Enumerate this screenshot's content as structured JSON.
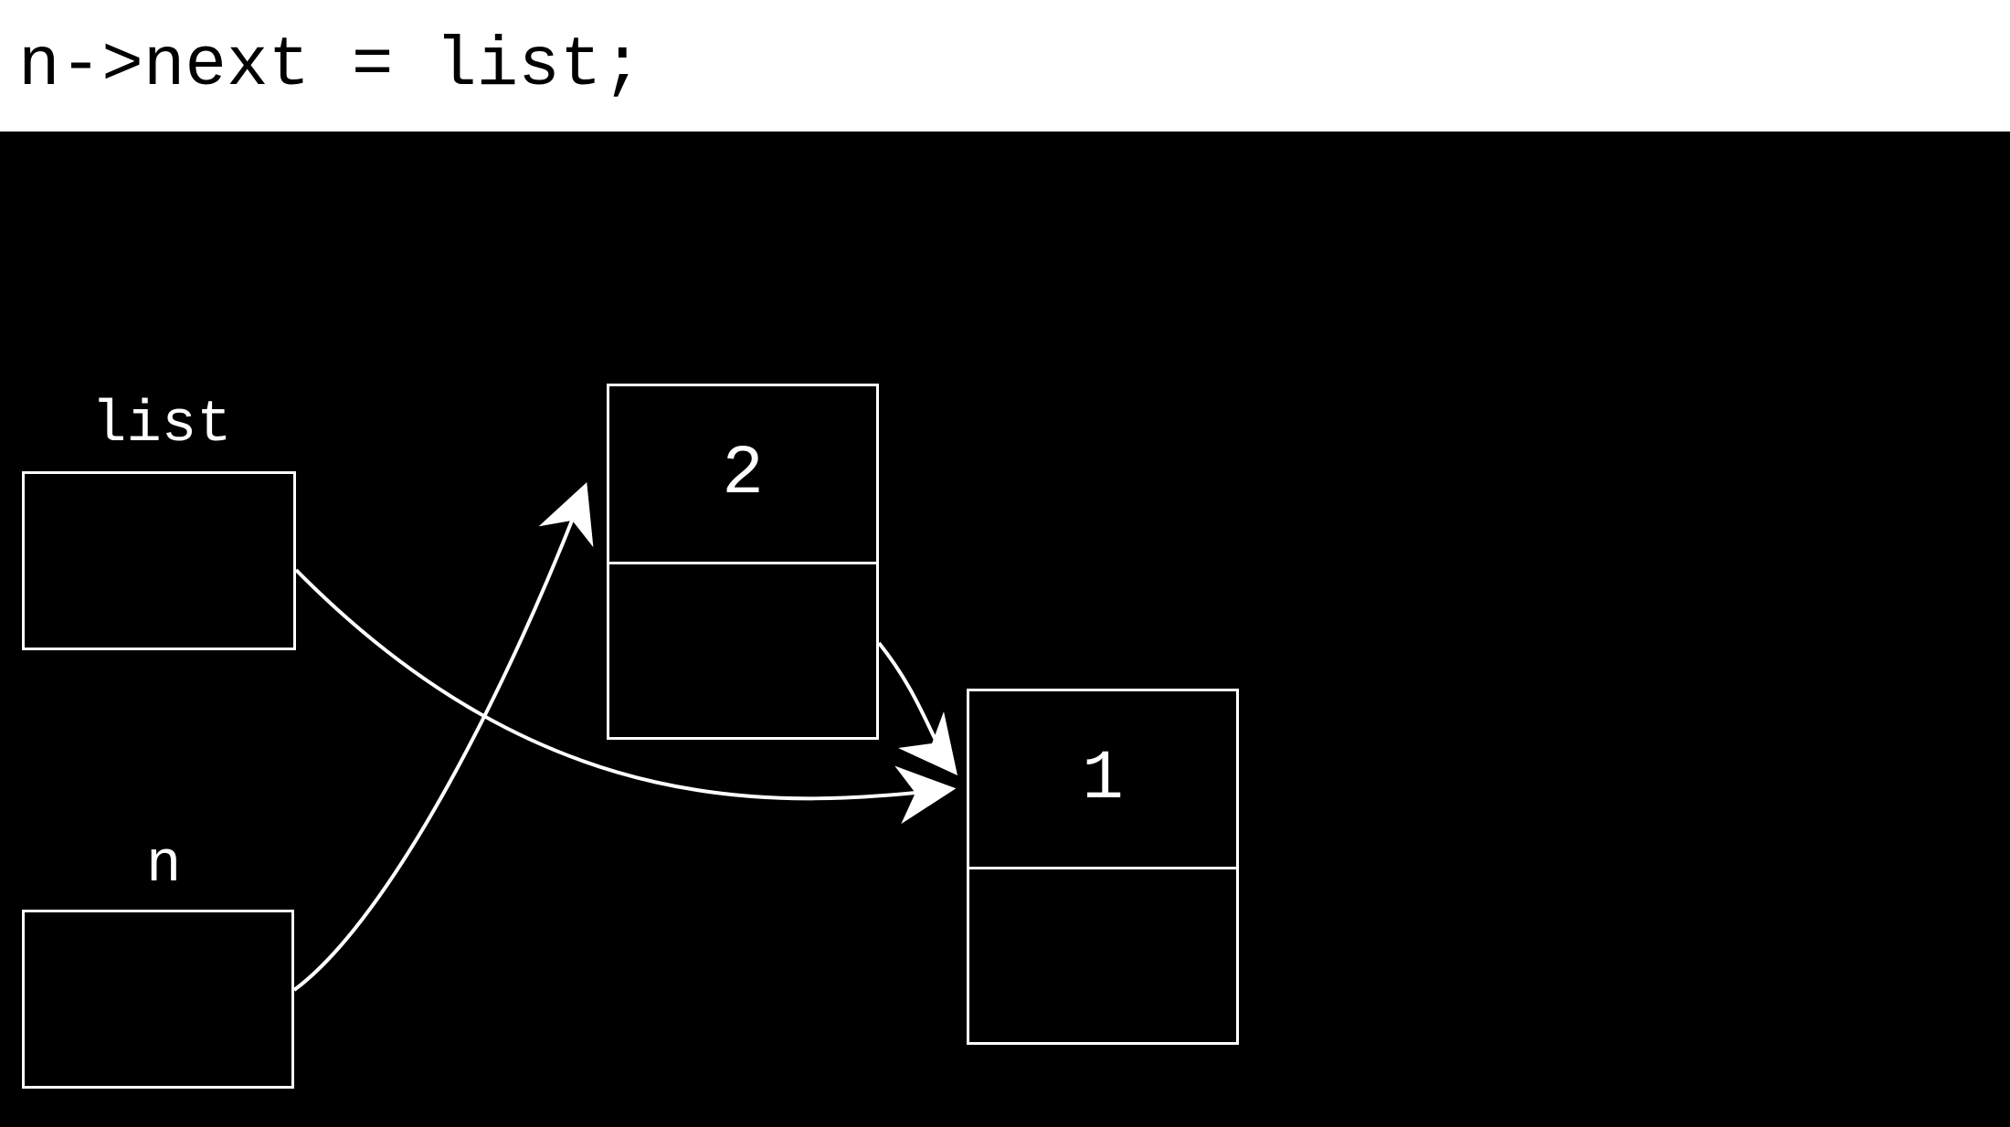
{
  "code_line": "n->next = list;",
  "pointers": {
    "list_label": "list",
    "n_label": "n"
  },
  "nodes": {
    "node_a_value": "2",
    "node_b_value": "1"
  },
  "diagram": {
    "description": "Linked-list pointer diagram: 'list' points to node 1, 'n' points to node 2, node 2's next points to node 1.",
    "edges": [
      {
        "from": "list",
        "to": "node_1"
      },
      {
        "from": "n",
        "to": "node_2"
      },
      {
        "from": "node_2.next",
        "to": "node_1"
      }
    ]
  },
  "colors": {
    "bg": "#000000",
    "fg": "#ffffff",
    "header_bg": "#ffffff",
    "header_fg": "#000000"
  }
}
